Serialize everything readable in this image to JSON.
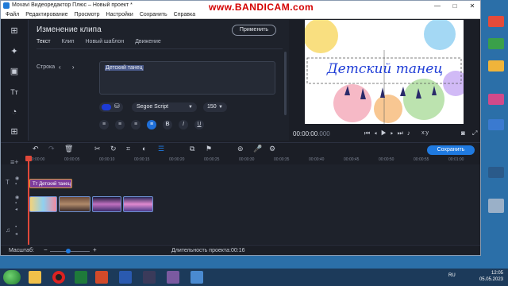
{
  "window": {
    "title": "Movavi Видеоредактор Плюс – Новый проект *",
    "watermark": "www.BANDICAM.com",
    "buttons": [
      "—",
      "□",
      "✕"
    ]
  },
  "menu": [
    "Файл",
    "Редактирование",
    "Просмотр",
    "Настройки",
    "Сохранить",
    "Справка"
  ],
  "sidebar": {
    "icons": [
      "import-icon",
      "magic-wand-icon",
      "filters-icon",
      "titles-icon",
      "transitions-icon",
      "more-tools-icon"
    ]
  },
  "clip_editor": {
    "title": "Изменение клипа",
    "apply_label": "Применить",
    "tabs": [
      "Текст",
      "Клип",
      "Новый шаблон",
      "Движение"
    ],
    "row_label": "Строка",
    "arrows": "‹ ›",
    "text_value": "Детский танец",
    "color": "#1d3bd6",
    "font": "Segoe Script",
    "size": "150",
    "format_buttons": [
      "≡",
      "≡",
      "≡",
      "≡",
      "B",
      "I",
      "U"
    ]
  },
  "preview": {
    "title_text": "Детский танец",
    "timecode": "00:00:00",
    "timecode_frac": ".000",
    "aspect": "x:y"
  },
  "toolbar": {
    "save_label": "Сохранить"
  },
  "timeline": {
    "ruler": [
      "00:00:00",
      "00:00:05",
      "00:00:10",
      "00:00:15",
      "00:00:20",
      "00:00:25",
      "00:00:30",
      "00:00:35",
      "00:00:40",
      "00:00:45",
      "00:00:50",
      "00:00:55",
      "00:01:00"
    ],
    "title_clip_label": "Тт Детский танец"
  },
  "status": {
    "zoom_label": "Масштаб:",
    "duration_label": "Длительность проекта:",
    "duration": "00:16"
  },
  "taskbar": {
    "lang": "RU",
    "time": "12:05",
    "date": "05.05.2023"
  },
  "colors": {
    "accent": "#1f7ae0",
    "title_clip": "#7e3c9c",
    "playhead": "#e0483a"
  }
}
